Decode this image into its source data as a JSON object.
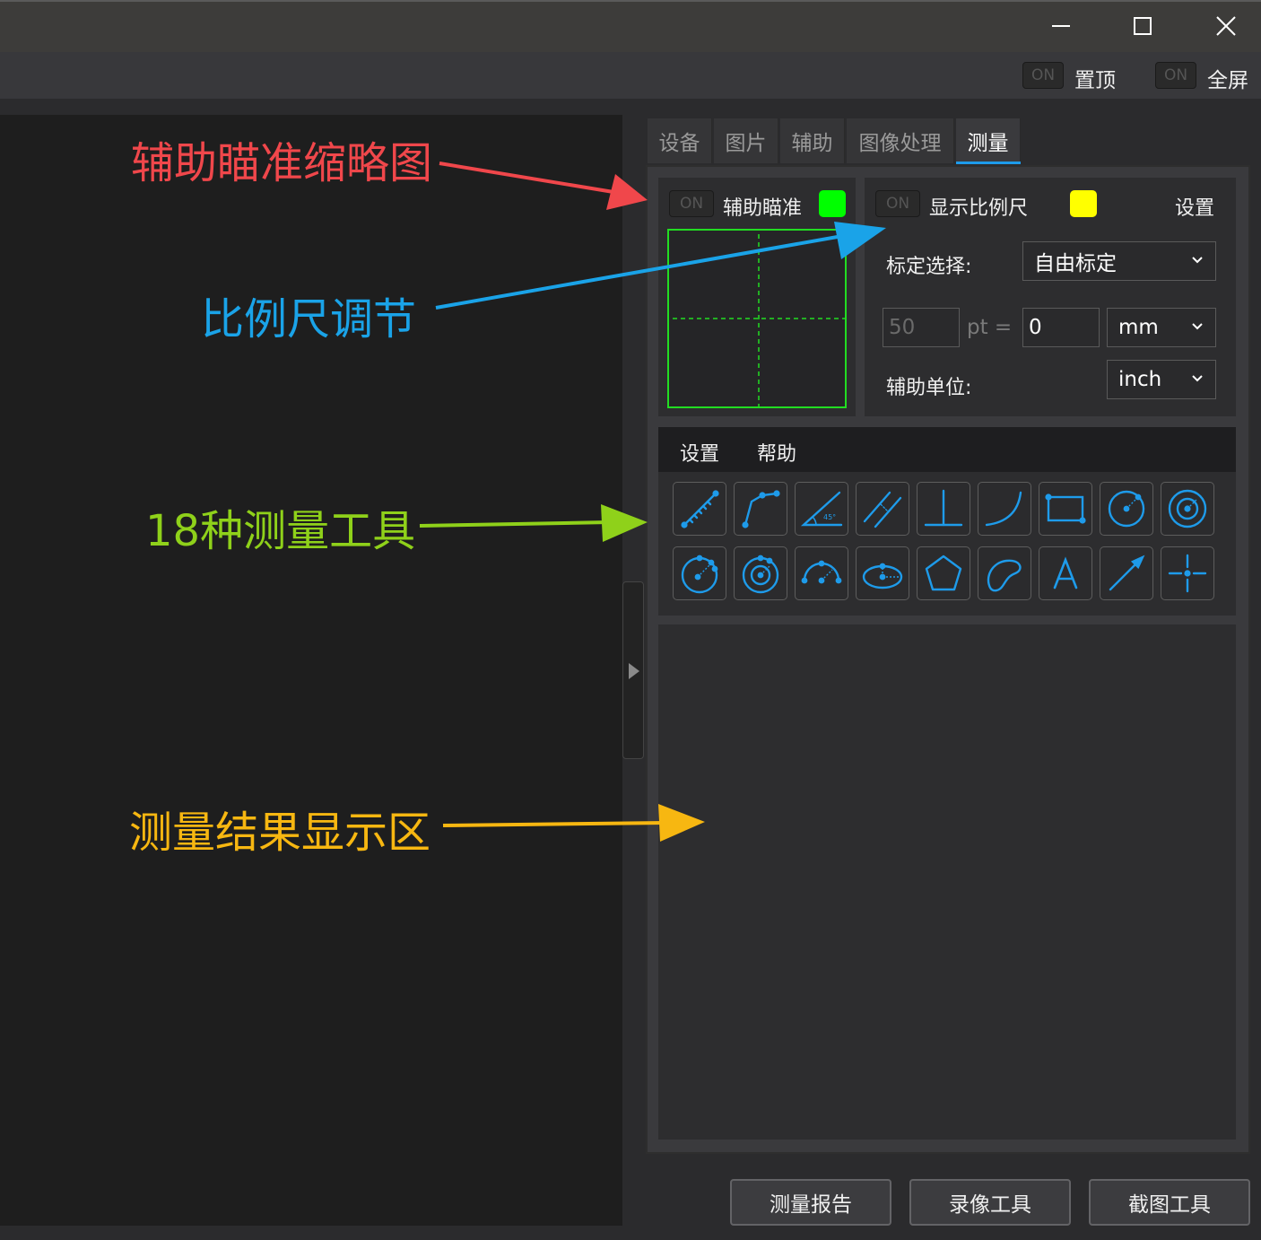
{
  "window": {
    "controls": [
      "minimize",
      "maximize",
      "close"
    ]
  },
  "toolbar": {
    "pin": {
      "badge": "ON",
      "label": "置顶"
    },
    "fullscreen": {
      "badge": "ON",
      "label": "全屏"
    }
  },
  "tabs": [
    {
      "label": "设备",
      "active": false
    },
    {
      "label": "图片",
      "active": false
    },
    {
      "label": "辅助",
      "active": false
    },
    {
      "label": "图像处理",
      "active": false
    },
    {
      "label": "测量",
      "active": true
    }
  ],
  "aim": {
    "badge": "ON",
    "label": "辅助瞄准",
    "color": "#00ff00"
  },
  "scale": {
    "badge": "ON",
    "label": "显示比例尺",
    "color": "#ffff00",
    "settings_label": "设置",
    "calib_label": "标定选择:",
    "calib_value": "自由标定",
    "pt_value": "50",
    "pt_label": "pt =",
    "mm_value": "0",
    "unit_value": "mm",
    "aux_unit_label": "辅助单位:",
    "aux_unit_value": "inch"
  },
  "menu": {
    "settings": "设置",
    "help": "帮助"
  },
  "tools": [
    "ruler-line-icon",
    "polyline-icon",
    "angle-icon",
    "parallel-lines-icon",
    "perpendicular-icon",
    "arc-curve-icon",
    "rectangle-icon",
    "circle-radius-icon",
    "concentric-circle-icon",
    "three-point-circle-icon",
    "two-concentric-circles-icon",
    "arc-three-point-icon",
    "ellipse-icon",
    "pentagon-icon",
    "freehand-shape-icon",
    "text-icon",
    "arrow-icon",
    "crosshair-icon"
  ],
  "accent_color": "#1e9bea",
  "buttons": {
    "report": "测量报告",
    "record": "录像工具",
    "screenshot": "截图工具"
  },
  "annotations": {
    "thumbnail": {
      "text": "辅助瞄准缩略图",
      "color": "#f0474b"
    },
    "scale": {
      "text": "比例尺调节",
      "color": "#1aa3e8"
    },
    "tools": {
      "text": "18种测量工具",
      "color": "#8fd11a"
    },
    "results": {
      "text": "测量结果显示区",
      "color": "#f7b711"
    }
  }
}
